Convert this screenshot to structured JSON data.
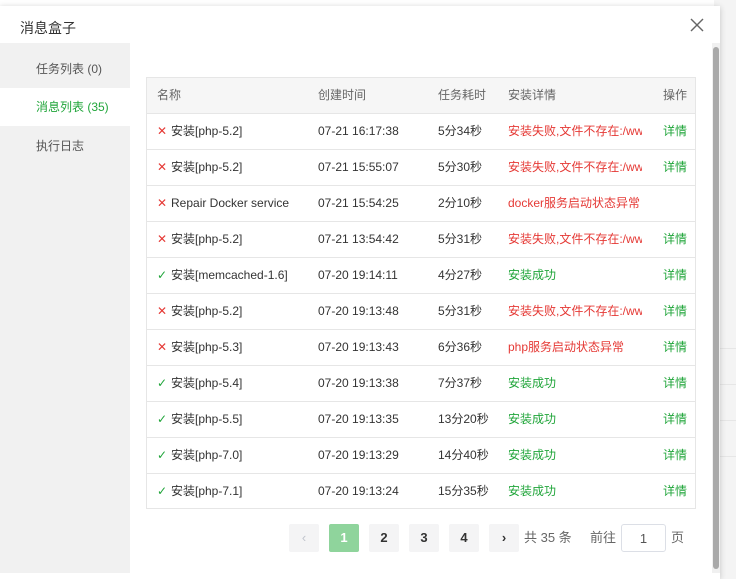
{
  "dialog": {
    "title": "消息盒子"
  },
  "sidebar": {
    "items": [
      {
        "label": "任务列表 (0)"
      },
      {
        "label": "消息列表 (35)"
      },
      {
        "label": "执行日志"
      }
    ]
  },
  "table": {
    "headers": [
      "名称",
      "创建时间",
      "任务耗时",
      "安装详情",
      "操作"
    ],
    "rows": [
      {
        "status": "fail",
        "name": "安装[php-5.2]",
        "created": "07-21 16:17:38",
        "duration": "5分34秒",
        "detail": "安装失败,文件不存在:/ww",
        "action": "详情"
      },
      {
        "status": "fail",
        "name": "安装[php-5.2]",
        "created": "07-21 15:55:07",
        "duration": "5分30秒",
        "detail": "安装失败,文件不存在:/ww",
        "action": "详情"
      },
      {
        "status": "fail",
        "name": "Repair Docker service",
        "created": "07-21 15:54:25",
        "duration": "2分10秒",
        "detail": "docker服务启动状态异常",
        "action": ""
      },
      {
        "status": "fail",
        "name": "安装[php-5.2]",
        "created": "07-21 13:54:42",
        "duration": "5分31秒",
        "detail": "安装失败,文件不存在:/ww",
        "action": "详情"
      },
      {
        "status": "ok",
        "name": "安装[memcached-1.6]",
        "created": "07-20 19:14:11",
        "duration": "4分27秒",
        "detail": "安装成功",
        "action": "详情"
      },
      {
        "status": "fail",
        "name": "安装[php-5.2]",
        "created": "07-20 19:13:48",
        "duration": "5分31秒",
        "detail": "安装失败,文件不存在:/ww",
        "action": "详情"
      },
      {
        "status": "fail",
        "name": "安装[php-5.3]",
        "created": "07-20 19:13:43",
        "duration": "6分36秒",
        "detail": "php服务启动状态异常",
        "action": "详情"
      },
      {
        "status": "ok",
        "name": "安装[php-5.4]",
        "created": "07-20 19:13:38",
        "duration": "7分37秒",
        "detail": "安装成功",
        "action": "详情"
      },
      {
        "status": "ok",
        "name": "安装[php-5.5]",
        "created": "07-20 19:13:35",
        "duration": "13分20秒",
        "detail": "安装成功",
        "action": "详情"
      },
      {
        "status": "ok",
        "name": "安装[php-7.0]",
        "created": "07-20 19:13:29",
        "duration": "14分40秒",
        "detail": "安装成功",
        "action": "详情"
      },
      {
        "status": "ok",
        "name": "安装[php-7.1]",
        "created": "07-20 19:13:24",
        "duration": "15分35秒",
        "detail": "安装成功",
        "action": "详情"
      }
    ]
  },
  "pagination": {
    "pages": [
      "1",
      "2",
      "3",
      "4"
    ],
    "current": "1",
    "total_text": "共 35 条",
    "goto_label": "前往",
    "goto_value": "1",
    "page_suffix": "页"
  },
  "icons": {
    "close": "close-icon",
    "fail": "cross-icon",
    "ok": "check-icon",
    "prev": "chevron-left-icon",
    "next": "chevron-right-icon"
  },
  "colors": {
    "accent": "#20a53a",
    "error": "#e53935",
    "active_page": "#8fd49c"
  }
}
